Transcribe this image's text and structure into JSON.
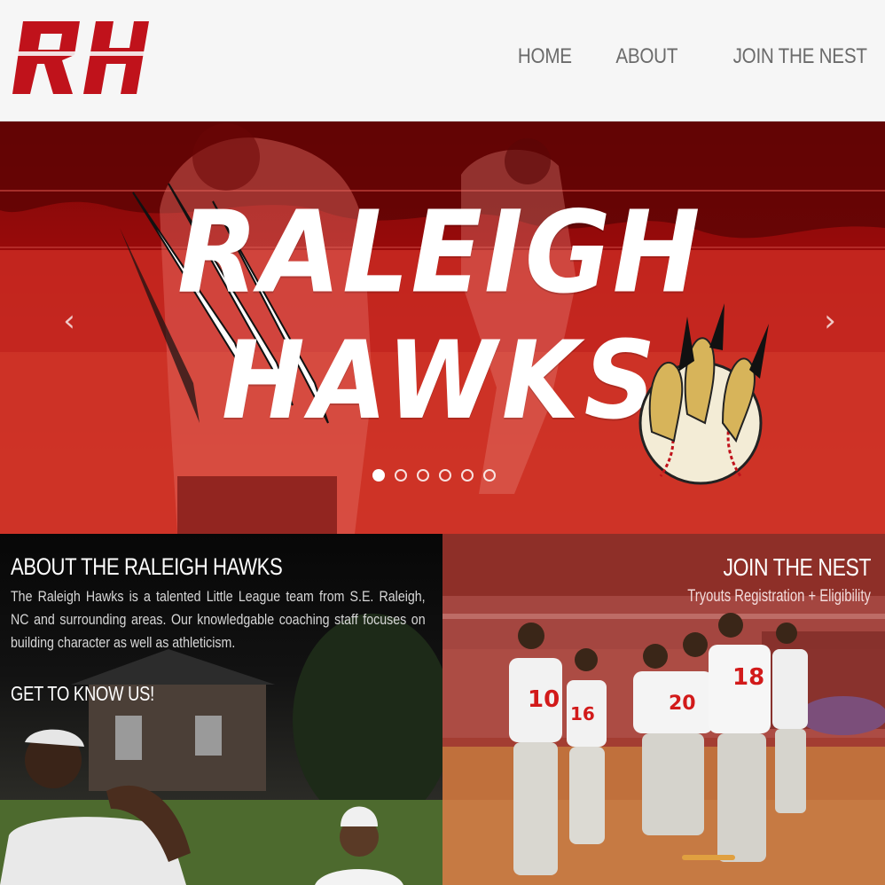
{
  "brand": {
    "logo_text": "RH",
    "logo_color": "#c0121b"
  },
  "nav": {
    "items": [
      {
        "label": "HOME"
      },
      {
        "label": "ABOUT"
      },
      {
        "label": "JOIN THE NEST"
      }
    ]
  },
  "hero": {
    "title_line1": "RALEIGH",
    "title_line2": "HAWKS",
    "prev_icon": "chevron-left-icon",
    "next_icon": "chevron-right-icon",
    "prev_glyph": "‹",
    "next_glyph": "›",
    "slide_count": 6,
    "active_slide": 1,
    "overlay_color": "#c00d0d"
  },
  "about": {
    "heading": "ABOUT THE RALEIGH HAWKS",
    "body": "The Raleigh Hawks is a talented Little League team from S.E. Raleigh, NC and surrounding areas. Our knowledgable coaching staff focuses on building character as well as athleticism.",
    "cta": "GET TO KNOW US!"
  },
  "join": {
    "heading": "JOIN THE NEST",
    "subheading": "Tryouts Registration + Eligibility",
    "jersey_numbers": [
      "10",
      "16",
      "20",
      "18"
    ]
  }
}
